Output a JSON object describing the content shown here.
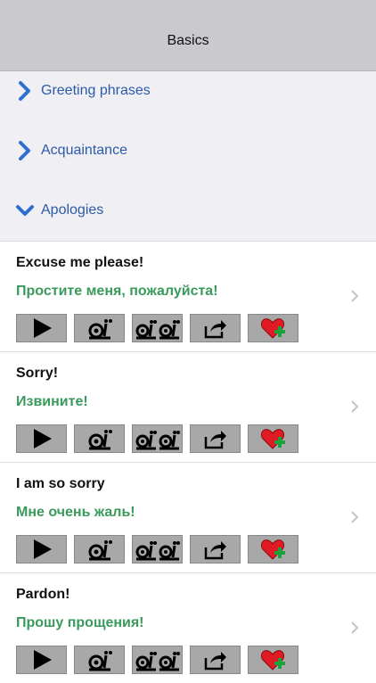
{
  "nav": {
    "title": "Basics"
  },
  "sections": [
    {
      "label": "Greeting phrases",
      "expanded": false
    },
    {
      "label": "Acquaintance",
      "expanded": false
    },
    {
      "label": "Apologies",
      "expanded": true
    }
  ],
  "phrases": [
    {
      "en": "Excuse me please!",
      "ru": "Простите меня, пожалуйста!"
    },
    {
      "en": "Sorry!",
      "ru": "Извините!"
    },
    {
      "en": "I am so sorry",
      "ru": "Мне очень жаль!"
    },
    {
      "en": "Pardon!",
      "ru": "Прошу прощения!"
    }
  ],
  "icons": {
    "play": "play-icon",
    "slow": "snail-icon",
    "slower": "double-snail-icon",
    "share": "share-icon",
    "favorite": "heart-plus-icon"
  },
  "colors": {
    "section_text": "#2d5aa8",
    "translation_text": "#3a9a5c",
    "button_bg": "#a8a8a8"
  }
}
